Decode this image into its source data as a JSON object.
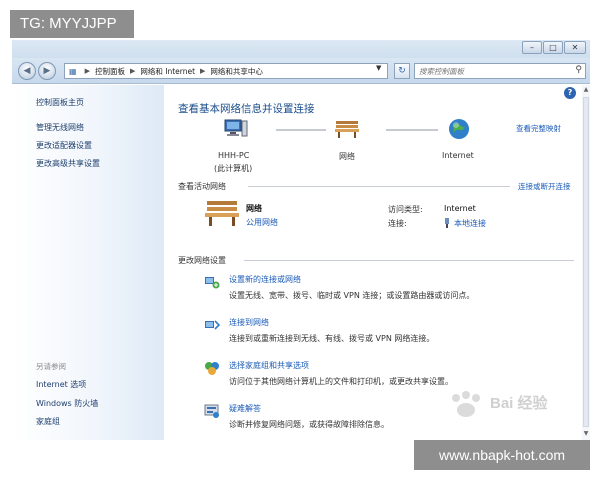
{
  "overlays": {
    "tag": "TG: MYYJJPP",
    "url": "www.nbapk-hot.com",
    "watermark": "Bai 经验"
  },
  "address": {
    "crumbs": [
      "控制面板",
      "网络和 Internet",
      "网络和共享中心"
    ]
  },
  "search": {
    "placeholder": "搜索控制面板"
  },
  "sidebar": {
    "links": [
      "控制面板主页",
      "管理无线网络",
      "更改适配器设置",
      "更改高级共享设置"
    ],
    "see_also_title": "另请参阅",
    "see_also": [
      "Internet 选项",
      "Windows 防火墙",
      "家庭组"
    ]
  },
  "main": {
    "title": "查看基本网络信息并设置连接",
    "full_map_link": "查看完整映射",
    "map": {
      "computer_name": "HHH-PC",
      "computer_sub": "(此计算机)",
      "network": "网络",
      "internet": "Internet"
    },
    "active": {
      "header": "查看活动网络",
      "connect_link": "连接或断开连接",
      "network_name": "网络",
      "network_type": "公用网络",
      "access_label": "访问类型:",
      "access_value": "Internet",
      "connections_label": "连接:",
      "connections_value": "本地连接"
    },
    "change": {
      "header": "更改网络设置",
      "tasks": [
        {
          "link": "设置新的连接或网络",
          "desc": "设置无线、宽带、拨号、临时或 VPN 连接；或设置路由器或访问点。"
        },
        {
          "link": "连接到网络",
          "desc": "连接到或重新连接到无线、有线、拨号或 VPN 网络连接。"
        },
        {
          "link": "选择家庭组和共享选项",
          "desc": "访问位于其他网络计算机上的文件和打印机，或更改共享设置。"
        },
        {
          "link": "疑难解答",
          "desc": "诊断并修复网络问题，或获得故障排除信息。"
        }
      ]
    }
  },
  "colors": {
    "link_blue": "#1a5bb8",
    "title_blue": "#1a4d8c",
    "overlay_gray": "#8e8e8e"
  }
}
